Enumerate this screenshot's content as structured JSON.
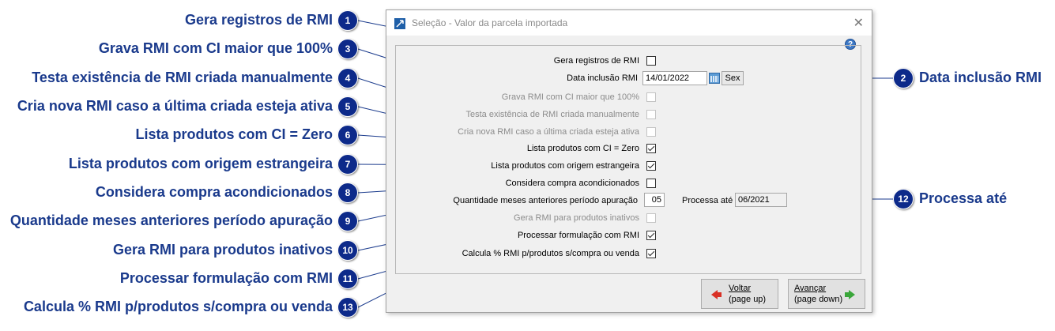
{
  "dialog": {
    "title": "Seleção - Valor da parcela importada",
    "close_symbol": "✕",
    "help_symbol": "?"
  },
  "fields": {
    "gera_registros": {
      "label": "Gera registros de RMI",
      "checked": false
    },
    "data_inclusao": {
      "label": "Data inclusão RMI",
      "value": "14/01/2022",
      "day": "Sex"
    },
    "grava_ci": {
      "label": "Grava RMI com CI maior que 100%",
      "checked": false
    },
    "testa_existencia": {
      "label": "Testa existência de RMI criada manualmente",
      "checked": false
    },
    "cria_nova": {
      "label": "Cria nova RMI caso a última criada esteja ativa",
      "checked": false
    },
    "lista_ci_zero": {
      "label": "Lista produtos com CI = Zero",
      "checked": true
    },
    "lista_origem": {
      "label": "Lista produtos com origem estrangeira",
      "checked": true
    },
    "considera_compra": {
      "label": "Considera compra acondicionados",
      "checked": false
    },
    "quantidade_meses": {
      "label": "Quantidade meses anteriores período apuração",
      "value": "05"
    },
    "processa_ate": {
      "label": "Processa até",
      "value": "06/2021"
    },
    "gera_inativos": {
      "label": "Gera RMI para produtos inativos",
      "checked": false
    },
    "processar_formulacao": {
      "label": "Processar formulação com RMI",
      "checked": true
    },
    "calcula_rmi": {
      "label": "Calcula % RMI p/produtos s/compra ou venda",
      "checked": true
    }
  },
  "buttons": {
    "voltar": {
      "label": "Voltar",
      "sub": "(page up)"
    },
    "avancar": {
      "label": "Avançar",
      "sub": "(page down)"
    }
  },
  "callouts": {
    "c1": {
      "num": "1",
      "text": "Gera registros de RMI"
    },
    "c2": {
      "num": "2",
      "text": "Data inclusão RMI"
    },
    "c3": {
      "num": "3",
      "text": "Grava RMI com CI maior que 100%"
    },
    "c4": {
      "num": "4",
      "text": "Testa existência de RMI criada manualmente"
    },
    "c5": {
      "num": "5",
      "text": "Cria nova RMI caso a última criada esteja ativa"
    },
    "c6": {
      "num": "6",
      "text": "Lista produtos com CI = Zero"
    },
    "c7": {
      "num": "7",
      "text": "Lista produtos com origem estrangeira"
    },
    "c8": {
      "num": "8",
      "text": "Considera compra acondicionados"
    },
    "c9": {
      "num": "9",
      "text": "Quantidade meses anteriores período apuração"
    },
    "c10": {
      "num": "10",
      "text": "Gera RMI para produtos inativos"
    },
    "c11": {
      "num": "11",
      "text": "Processar formulação com RMI"
    },
    "c12": {
      "num": "12",
      "text": "Processa até"
    },
    "c13": {
      "num": "13",
      "text": "Calcula % RMI p/produtos s/compra ou venda"
    }
  },
  "colors": {
    "callout_text": "#1a3a8c",
    "badge": "#0d2a8a",
    "connector": "#1a3a8c"
  }
}
